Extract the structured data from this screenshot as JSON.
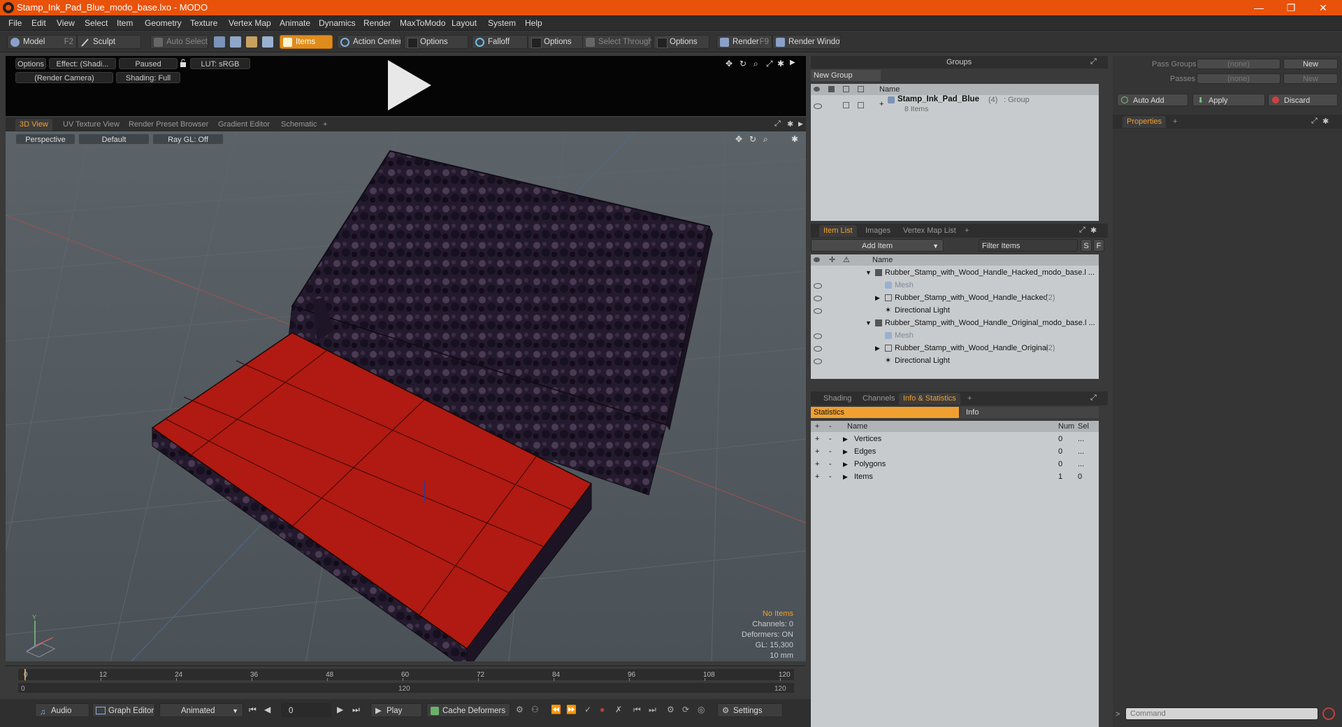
{
  "window": {
    "title": "Stamp_Ink_Pad_Blue_modo_base.lxo - MODO",
    "minimize": "—",
    "restore": "❐",
    "close": "✕"
  },
  "menu": [
    "File",
    "Edit",
    "View",
    "Select",
    "Item",
    "Geometry",
    "Texture",
    "Vertex Map",
    "Animate",
    "Dynamics",
    "Render",
    "MaxToModo",
    "Layout",
    "System",
    "Help"
  ],
  "toolbar": {
    "model": "Model",
    "model_key": "F2",
    "sculpt": "Sculpt",
    "auto_select": "Auto Select",
    "items": "Items",
    "action_center": "Action Center",
    "options1": "Options",
    "falloff": "Falloff",
    "options2": "Options",
    "select_through": "Select Through",
    "options3": "Options",
    "render": "Render",
    "render_key": "F9",
    "render_window": "Render Window"
  },
  "preview": {
    "options": "Options",
    "effect": "Effect: (Shadi...",
    "paused": "Paused",
    "lut": "LUT: sRGB",
    "camera": "(Render Camera)",
    "shading": "Shading: Full"
  },
  "viewport_tabs": [
    "3D View",
    "UV Texture View",
    "Render Preset Browser",
    "Gradient Editor",
    "Schematic",
    "+"
  ],
  "viewport": {
    "perspective": "Perspective",
    "default": "Default",
    "raygl": "Ray GL: Off",
    "info": {
      "no_items": "No Items",
      "channels": "Channels: 0",
      "deformers": "Deformers: ON",
      "gl": "GL: 15,300",
      "unit": "10 mm"
    }
  },
  "timeline": {
    "ticks": [
      "0",
      "12",
      "24",
      "36",
      "48",
      "60",
      "72",
      "84",
      "96",
      "108",
      "120"
    ],
    "start": "0",
    "mid": "120",
    "end": "120"
  },
  "bottombar": {
    "audio": "Audio",
    "graph_editor": "Graph Editor",
    "animated": "Animated",
    "frame": "0",
    "play": "Play",
    "cache_deformers": "Cache Deformers",
    "settings": "Settings"
  },
  "groups": {
    "title": "Groups",
    "new_group": "New Group",
    "col_name": "Name",
    "item_name": "Stamp_Ink_Pad_Blue",
    "item_count": "(4)",
    "item_type": ": Group",
    "item_sub": "8 Items"
  },
  "itemlist": {
    "tabs": [
      "Item List",
      "Images",
      "Vertex Map List",
      "+"
    ],
    "add_item": "Add Item",
    "filter": "Filter Items",
    "s": "S",
    "f": "F",
    "col_name": "Name",
    "rows": [
      {
        "label": "Rubber_Stamp_with_Wood_Handle_Hacked_modo_base.l ...",
        "count": ""
      },
      {
        "label": "Mesh",
        "count": ""
      },
      {
        "label": "Rubber_Stamp_with_Wood_Handle_Hacked",
        "count": "(2)"
      },
      {
        "label": "Directional Light",
        "count": ""
      },
      {
        "label": "Rubber_Stamp_with_Wood_Handle_Original_modo_base.l ...",
        "count": ""
      },
      {
        "label": "Mesh",
        "count": ""
      },
      {
        "label": "Rubber_Stamp_with_Wood_Handle_Original",
        "count": "(2)"
      },
      {
        "label": "Directional Light",
        "count": ""
      }
    ]
  },
  "stats": {
    "tabs": [
      "Shading",
      "Channels",
      "Info & Statistics",
      "+"
    ],
    "statistics": "Statistics",
    "info": "Info",
    "col_name": "Name",
    "col_num": "Num",
    "col_sel": "Sel",
    "rows": [
      {
        "name": "Vertices",
        "num": "0",
        "sel": "..."
      },
      {
        "name": "Edges",
        "num": "0",
        "sel": "..."
      },
      {
        "name": "Polygons",
        "num": "0",
        "sel": "..."
      },
      {
        "name": "Items",
        "num": "1",
        "sel": "0"
      }
    ]
  },
  "passes": {
    "pass_groups": "Pass Groups",
    "passes": "Passes",
    "none1": "(none)",
    "none2": "(none)",
    "new1": "New",
    "new2": "New",
    "auto_add": "Auto Add",
    "apply": "Apply",
    "discard": "Discard",
    "properties": "Properties",
    "plus": "+"
  },
  "command": {
    "placeholder": "Command",
    "prompt": ">"
  },
  "colors": {
    "accent": "#e8520a",
    "active_tab": "#f0a030",
    "pad_red": "#b01a12"
  }
}
